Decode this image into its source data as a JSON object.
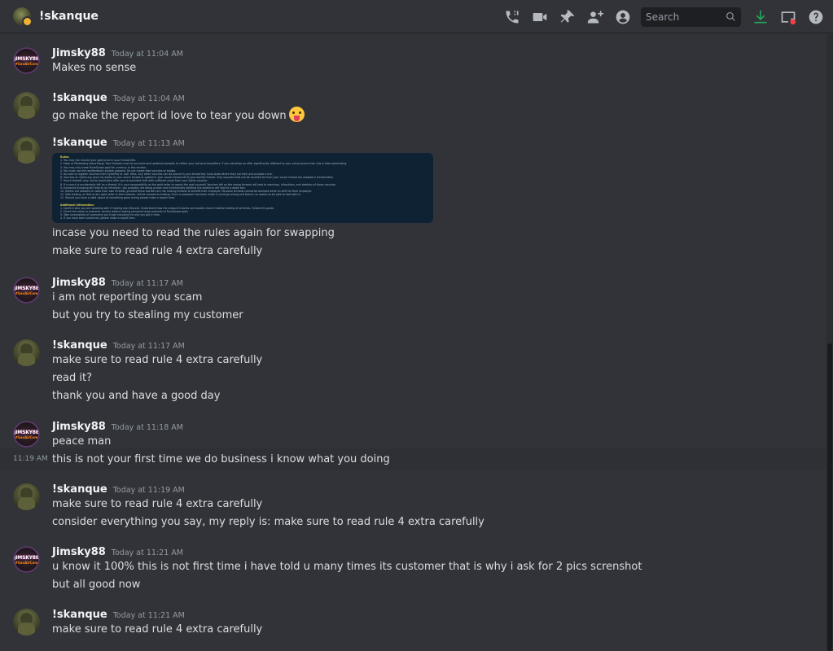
{
  "header": {
    "title": "!skanque",
    "search_placeholder": "Search",
    "icons": [
      "call-icon",
      "video-icon",
      "pin-icon",
      "add-friend-icon",
      "profile-icon",
      "search-icon",
      "download-icon",
      "inbox-icon",
      "help-icon"
    ]
  },
  "messages": [
    {
      "author": "Jimsky88",
      "time": "Today at 11:04 AM",
      "lines": [
        "Makes no sense"
      ]
    },
    {
      "author": "!skanque",
      "time": "Today at 11:04 AM",
      "lines": [
        "go make the report id love to tear you down"
      ],
      "emoji": "face-with-tongue"
    },
    {
      "author": "!skanque",
      "time": "Today at 11:13 AM",
      "lines": [
        "incase you need to read the rules again for swapping",
        "make sure to read rule 4 extra carefully"
      ]
    },
    {
      "author": "Jimsky88",
      "time": "Today at 11:17 AM",
      "lines": [
        "i am not reporting you scam",
        "but you try to stealing my customer"
      ]
    },
    {
      "author": "!skanque",
      "time": "Today at 11:17 AM",
      "lines": [
        "make sure to read rule 4 extra carefully",
        "read it?",
        "thank you and have a good day"
      ]
    },
    {
      "author": "Jimsky88",
      "time": "Today at 11:18 AM",
      "lines": [
        "peace man",
        "this is not your first time we do business i know what you doing"
      ],
      "hover_time": "11:19 AM"
    },
    {
      "author": "!skanque",
      "time": "Today at 11:19 AM",
      "lines": [
        "make sure to read rule 4 extra carefully",
        "consider everything you say, my reply is: make sure to read rule 4 extra carefully"
      ]
    },
    {
      "author": "Jimsky88",
      "time": "Today at 11:21 AM",
      "lines": [
        "u know it 100% this is not first time i have told u many times its customer that is why i ask for 2 pics screnshot",
        "but all good now"
      ]
    },
    {
      "author": "!skanque",
      "time": "Today at 11:21 AM",
      "lines": [
        "make sure to read rule 4 extra carefully"
      ]
    }
  ],
  "avatar_text": {
    "jimsky_line1": "JIMSKY88",
    "jimsky_line2": "#SavAirCom"
  },
  "colors": {
    "background": "#313338",
    "username": "#f2f3f5",
    "timestamp": "#949ba4",
    "text": "#dbdee1",
    "download_icon": "#23a55a",
    "status_dot": "#f23f43"
  }
}
